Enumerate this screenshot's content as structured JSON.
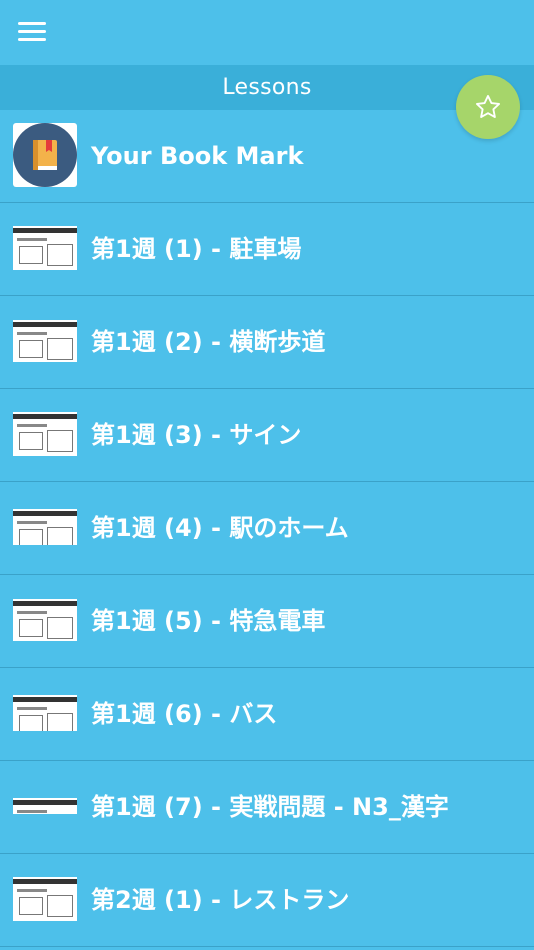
{
  "header": {
    "menu_icon": "hamburger-menu-icon",
    "title": "Lessons"
  },
  "fab": {
    "icon": "star-outline-icon",
    "color": "#a6d56a"
  },
  "colors": {
    "background": "#4dc0ea",
    "subheader": "#3aafd9",
    "divider": "#3aa2c9"
  },
  "lessons": [
    {
      "label": "Your Book Mark",
      "icon": "bookmark-book-icon"
    },
    {
      "label": "第1週 (1) - 駐車場",
      "icon": "lesson-thumbnail"
    },
    {
      "label": "第1週 (2) - 横断歩道",
      "icon": "lesson-thumbnail"
    },
    {
      "label": "第1週 (3) - サイン",
      "icon": "lesson-thumbnail"
    },
    {
      "label": "第1週 (4) - 駅のホーム",
      "icon": "lesson-thumbnail"
    },
    {
      "label": "第1週 (5) - 特急電車",
      "icon": "lesson-thumbnail"
    },
    {
      "label": "第1週 (6) - バス",
      "icon": "lesson-thumbnail"
    },
    {
      "label": "第1週 (7) - 実戦問題 - N3_漢字",
      "icon": "lesson-thumbnail"
    },
    {
      "label": "第2週 (1) - レストラン",
      "icon": "lesson-thumbnail"
    }
  ]
}
